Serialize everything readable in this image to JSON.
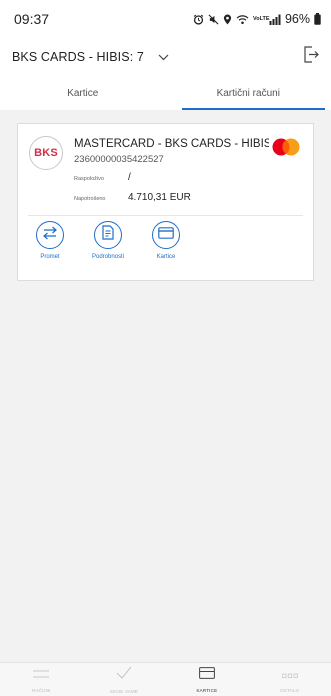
{
  "status_bar": {
    "time": "09:37",
    "battery": "96%",
    "network": "VoLTE"
  },
  "header": {
    "account_title": "BKS CARDS - HIBIS: 7"
  },
  "tabs": [
    {
      "label": "Kartice",
      "active": false
    },
    {
      "label": "Kartični računi",
      "active": true
    }
  ],
  "card": {
    "logo_text": "BKS",
    "name": "MASTERCARD - BKS CARDS - HIBIS: ...",
    "number": "23600000035422527",
    "rows": [
      {
        "label": "Raspoloživo",
        "value": "/"
      },
      {
        "label": "Napotrošeno",
        "value": "4.710,31 EUR"
      }
    ],
    "actions": [
      {
        "label": "Promet",
        "icon": "transfer-arrows-icon"
      },
      {
        "label": "Podrobnosti",
        "icon": "document-icon"
      },
      {
        "label": "Kartice",
        "icon": "card-icon"
      }
    ]
  },
  "bottom_nav": [
    {
      "label": "RAČUNI",
      "icon": "accounts-icon",
      "active": false
    },
    {
      "label": "MOJE VAME",
      "icon": "check-icon",
      "active": false
    },
    {
      "label": "KARTICE",
      "icon": "card-icon",
      "active": true
    },
    {
      "label": "OSTALO",
      "icon": "dots-icon",
      "active": false
    }
  ],
  "colors": {
    "accent": "#1e6ec8",
    "bks_red": "#d42c49",
    "mc_red": "#eb001b",
    "mc_orange": "#f79e1b"
  }
}
